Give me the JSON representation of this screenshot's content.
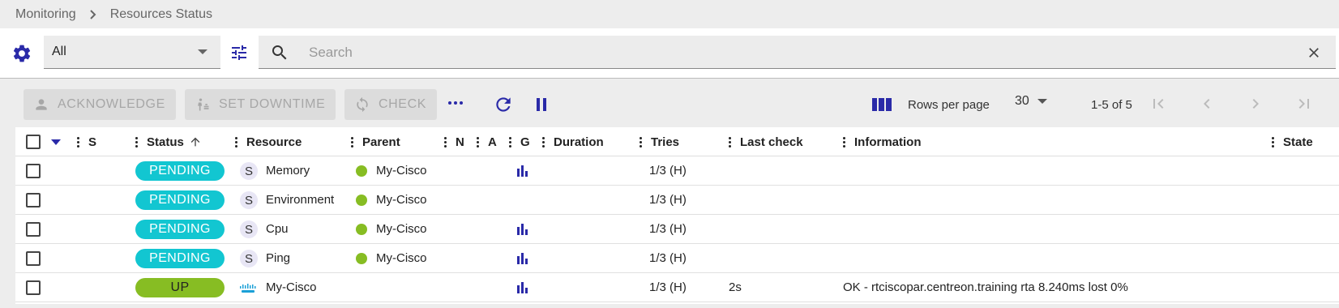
{
  "breadcrumb": {
    "items": [
      "Monitoring",
      "Resources Status"
    ]
  },
  "filter": {
    "selected": "All",
    "search_placeholder": "Search",
    "search_value": ""
  },
  "actions": {
    "acknowledge": "ACKNOWLEDGE",
    "set_downtime": "SET DOWNTIME",
    "check": "CHECK"
  },
  "pagination": {
    "rows_per_page_label": "Rows per page",
    "rows_per_page": "30",
    "count": "1-5 of 5"
  },
  "columns": [
    "S",
    "Status",
    "Resource",
    "Parent",
    "N",
    "A",
    "G",
    "Duration",
    "Tries",
    "Last check",
    "Information",
    "State"
  ],
  "colors": {
    "pending": "#12c6d1",
    "up": "#87bd23",
    "accent": "#2a2aa8",
    "parent_ok": "#87bd23"
  },
  "rows": [
    {
      "status": "PENDING",
      "status_color": "#12c6d1",
      "type": "S",
      "resource": "Memory",
      "parent": "My-Cisco",
      "graph": true,
      "tries": "1/3 (H)",
      "last_check": "",
      "information": ""
    },
    {
      "status": "PENDING",
      "status_color": "#12c6d1",
      "type": "S",
      "resource": "Environment",
      "parent": "My-Cisco",
      "graph": false,
      "tries": "1/3 (H)",
      "last_check": "",
      "information": ""
    },
    {
      "status": "PENDING",
      "status_color": "#12c6d1",
      "type": "S",
      "resource": "Cpu",
      "parent": "My-Cisco",
      "graph": true,
      "tries": "1/3 (H)",
      "last_check": "",
      "information": ""
    },
    {
      "status": "PENDING",
      "status_color": "#12c6d1",
      "type": "S",
      "resource": "Ping",
      "parent": "My-Cisco",
      "graph": true,
      "tries": "1/3 (H)",
      "last_check": "",
      "information": ""
    },
    {
      "status": "UP",
      "status_color": "#87bd23",
      "type": "cisco-logo",
      "resource": "My-Cisco",
      "parent": "",
      "graph": true,
      "tries": "1/3 (H)",
      "last_check": "2s",
      "information": "OK - rtciscopar.centreon.training rta 8.240ms lost 0%"
    }
  ]
}
